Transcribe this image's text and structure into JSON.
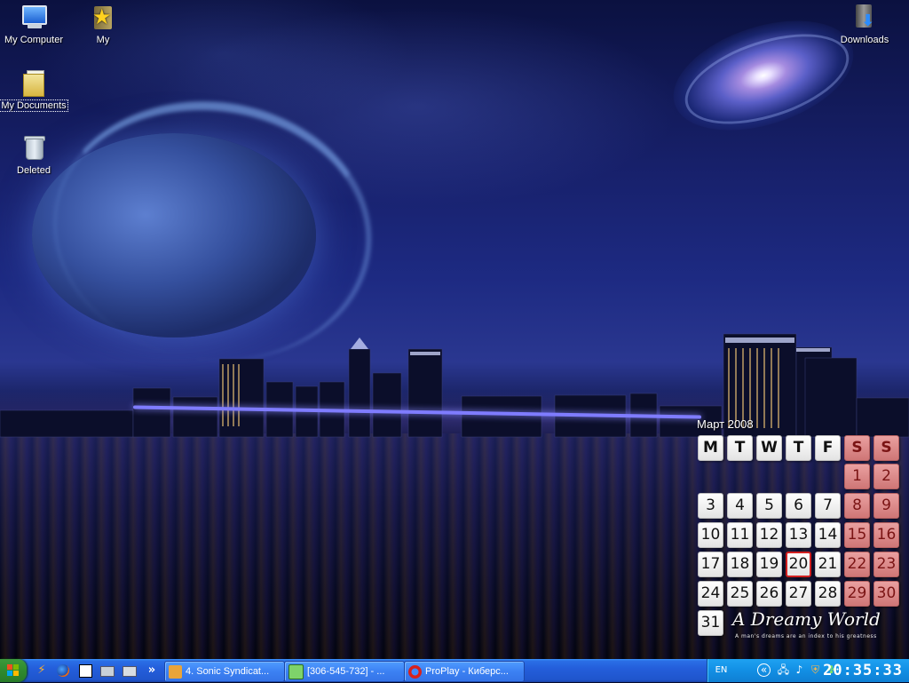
{
  "desktop": {
    "icons": [
      {
        "label": "My Computer",
        "icon": "computer-icon"
      },
      {
        "label": "My",
        "icon": "favorites-folder-icon"
      },
      {
        "label": "My Documents",
        "icon": "documents-folder-icon",
        "selected": true
      },
      {
        "label": "Deleted",
        "icon": "recycle-bin-icon"
      },
      {
        "label": "Downloads",
        "icon": "downloads-folder-icon"
      }
    ]
  },
  "calendar": {
    "title": "Март 2008",
    "headers": [
      "M",
      "T",
      "W",
      "T",
      "F",
      "S",
      "S"
    ],
    "weeks": [
      [
        "",
        "",
        "",
        "",
        "",
        "1",
        "2"
      ],
      [
        "3",
        "4",
        "5",
        "6",
        "7",
        "8",
        "9"
      ],
      [
        "10",
        "11",
        "12",
        "13",
        "14",
        "15",
        "16"
      ],
      [
        "17",
        "18",
        "19",
        "20",
        "21",
        "22",
        "23"
      ],
      [
        "24",
        "25",
        "26",
        "27",
        "28",
        "29",
        "30"
      ],
      [
        "31",
        "",
        "",
        "",
        "",
        "",
        ""
      ]
    ],
    "today": "20",
    "brand": "A Dreamy World",
    "motto": "A man's dreams are an index to his greatness"
  },
  "taskbar": {
    "quick_launch": [
      "winamp-icon",
      "firefox-icon",
      "media-icon",
      "network-icon",
      "printer-icon"
    ],
    "overflow": "»",
    "buttons": [
      {
        "label": "4. Sonic Syndicat...",
        "icon": "winamp-icon"
      },
      {
        "label": "[306-545-732] - ...",
        "icon": "chat-icon"
      },
      {
        "label": "ProPlay - Киберс...",
        "icon": "opera-icon"
      }
    ],
    "tray": {
      "language": "EN",
      "expand": "«",
      "icons": [
        "network-monitor-icon",
        "sound-icon",
        "shield-icon",
        "clover-icon"
      ],
      "clock": "20:35:33"
    }
  },
  "colors": {
    "taskbar": "#245edb",
    "start": "#2f8a2f",
    "tray": "#128fe4",
    "weekend_cell": "#cf7676",
    "today_border": "#d21f1f"
  }
}
